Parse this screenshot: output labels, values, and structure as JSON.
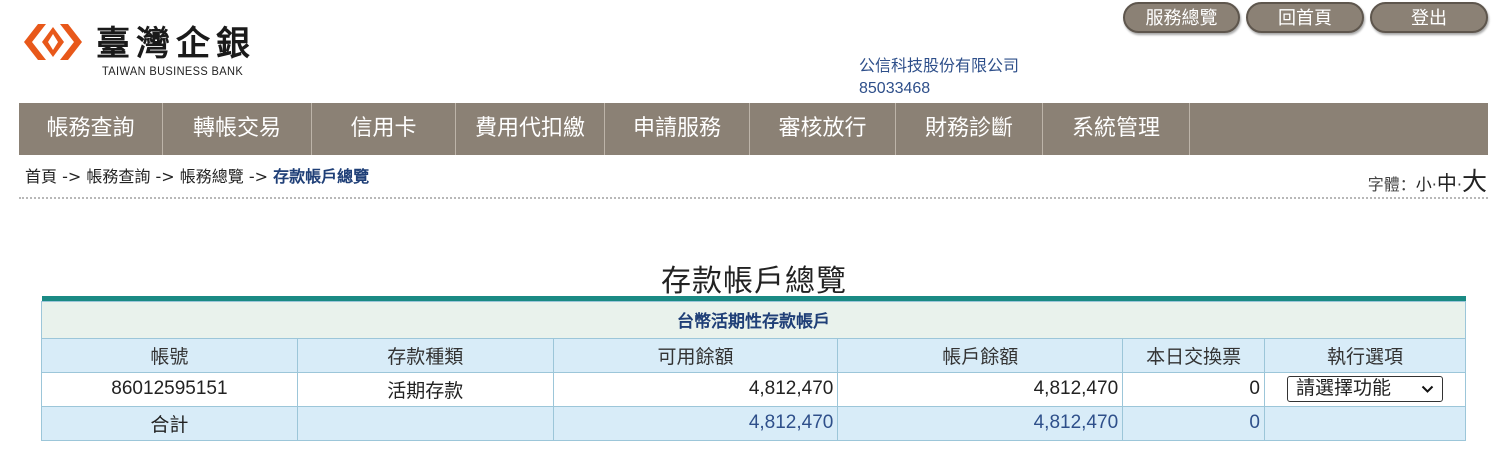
{
  "header": {
    "bank_name_cn": "臺灣企銀",
    "bank_name_en": "TAIWAN BUSINESS BANK",
    "logo_color": "#e8581a",
    "top_buttons": [
      "服務總覽",
      "回首頁",
      "登出"
    ],
    "company_name": "公信科技股份有限公司",
    "company_id": "85033468"
  },
  "nav": {
    "items": [
      "帳務查詢",
      "轉帳交易",
      "信用卡",
      "費用代扣繳",
      "申請服務",
      "審核放行",
      "財務診斷",
      "系統管理"
    ],
    "bg_color": "#8b8175"
  },
  "breadcrumb": {
    "items": [
      "首頁",
      "帳務查詢",
      "帳務總覽"
    ],
    "separator": " -> ",
    "current": "存款帳戶總覽"
  },
  "font_size": {
    "label": "字體：",
    "small": "小",
    "medium": "中",
    "large": "大",
    "dot": "·"
  },
  "page_title": "存款帳戶總覽",
  "table": {
    "caption": "台幣活期性存款帳戶",
    "columns": [
      "帳號",
      "存款種類",
      "可用餘額",
      "帳戶餘額",
      "本日交換票",
      "執行選項"
    ],
    "rows": [
      {
        "account": "86012595151",
        "type": "活期存款",
        "available": "4,812,470",
        "balance": "4,812,470",
        "exchange": "0",
        "action": "請選擇功能"
      }
    ],
    "total": {
      "label": "合計",
      "available": "4,812,470",
      "balance": "4,812,470",
      "exchange": "0"
    }
  }
}
